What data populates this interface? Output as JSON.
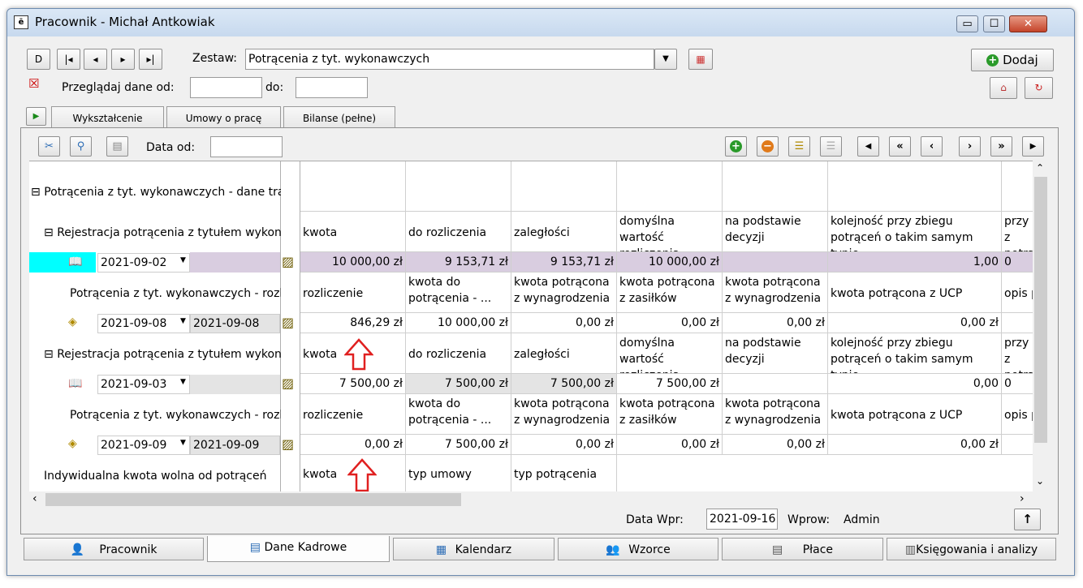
{
  "window": {
    "title": "Pracownik - Michał Antkowiak",
    "min": "▭",
    "max": "☐",
    "close": "✕"
  },
  "toolbar": {
    "nav": [
      "D",
      "|◂",
      "◂",
      "▸",
      "▸|"
    ],
    "zestaw_label": "Zestaw:",
    "zestaw_value": "Potrącenia z tyt. wykonawczych",
    "dodaj_label": "Dodaj",
    "przegladaj_label": "Przeglądaj dane od:",
    "do_label": "do:",
    "przegladaj_od": "",
    "przegladaj_do": ""
  },
  "top_tabs": [
    "Wykształcenie",
    "Umowy o pracę",
    "Bilanse (pełne)"
  ],
  "panel": {
    "data_od_label": "Data od:",
    "data_od_value": ""
  },
  "grid": {
    "group_title": "Potrącenia z tyt. wykonawczych - dane tran...",
    "reg1": {
      "label": "Rejestracja potrącenia z tytułem wykona...",
      "headers": [
        "kwota",
        "do rozliczenia",
        "zaległości",
        "domyślna wartość rozliczenia",
        "na podstawie decyzji",
        "kolejność przy zbiegu potrąceń o takim samym typie",
        "przy z potrą"
      ],
      "date": "2021-09-02",
      "values": [
        "10 000,00 zł",
        "9 153,71 zł",
        "9 153,71 zł",
        "10 000,00 zł",
        "",
        "1,00",
        "0"
      ]
    },
    "sub1": {
      "label": "Potrącenia z tyt. wykonawczych - rozli...",
      "headers": [
        "rozliczenie",
        "kwota do potrącenia - ...",
        "kwota potrącona z wynagrodzenia",
        "kwota potrącona z zasiłków",
        "kwota potrącona z wynagrodzenia ...",
        "kwota potrącona z UCP",
        "opis p"
      ],
      "date": "2021-09-08",
      "date2": "2021-09-08",
      "values": [
        "846,29 zł",
        "10 000,00 zł",
        "0,00 zł",
        "0,00 zł",
        "0,00 zł",
        "0,00 zł",
        ""
      ]
    },
    "reg2": {
      "label": "Rejestracja potrącenia z tytułem wykona...",
      "headers": [
        "kwota",
        "do rozliczenia",
        "zaległości",
        "domyślna wartość rozliczenia",
        "na podstawie decyzji",
        "kolejność przy zbiegu potrąceń o takim samym typie",
        "przy z potrą"
      ],
      "date": "2021-09-03",
      "values": [
        "7 500,00 zł",
        "7 500,00 zł",
        "7 500,00 zł",
        "7 500,00 zł",
        "",
        "0,00",
        "0"
      ]
    },
    "sub2": {
      "label": "Potrącenia z tyt. wykonawczych - rozli...",
      "headers": [
        "rozliczenie",
        "kwota do potrącenia - ...",
        "kwota potrącona z wynagrodzenia",
        "kwota potrącona z zasiłków",
        "kwota potrącona z wynagrodzenia ...",
        "kwota potrącona z UCP",
        "opis p"
      ],
      "date": "2021-09-09",
      "date2": "2021-09-09",
      "values": [
        "0,00 zł",
        "7 500,00 zł",
        "0,00 zł",
        "0,00 zł",
        "0,00 zł",
        "0,00 zł",
        ""
      ]
    },
    "indyw": {
      "label": "Indywidualna kwota wolna od potrąceń",
      "headers": [
        "kwota",
        "typ umowy",
        "typ potrącenia"
      ]
    }
  },
  "status": {
    "data_wpr_label": "Data Wpr:",
    "data_wpr_value": "2021-09-16",
    "wprow_label": "Wprow:",
    "wprow_value": "Admin"
  },
  "bottom_tabs": [
    "Pracownik",
    "Dane Kadrowe",
    "Kalendarz",
    "Wzorce",
    "Płace",
    "Księgowania i analizy"
  ],
  "colors": {
    "selected_row": "#d9cde0",
    "row_marker": "#00ffff",
    "arrow": "#e02020"
  }
}
